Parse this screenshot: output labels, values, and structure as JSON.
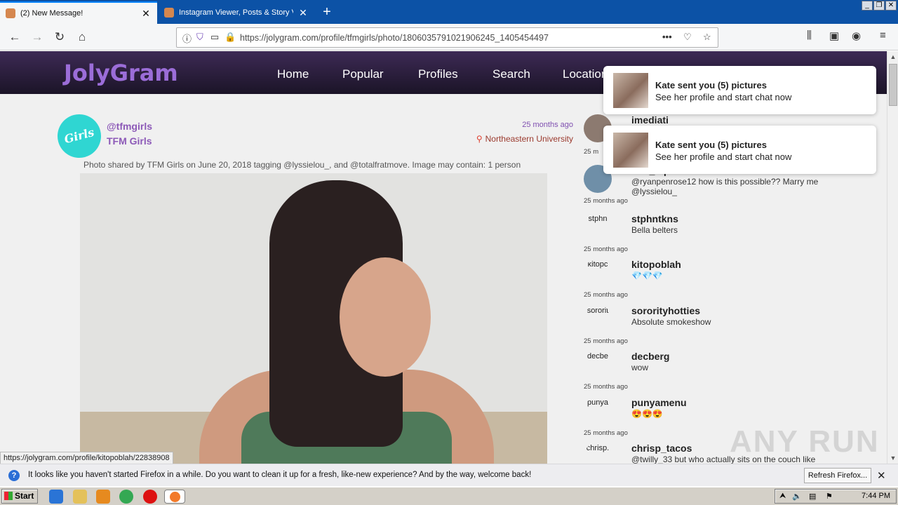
{
  "browser": {
    "tabs": [
      {
        "label": "(2) New Message!",
        "active": true
      },
      {
        "label": "Instagram Viewer, Posts & Story V",
        "active": false
      }
    ],
    "url": "https://jolygram.com/profile/tfmgirls/photo/1806035791021906245_1405454497",
    "status_url": "https://jolygram.com/profile/kitopoblah/22838908"
  },
  "site": {
    "logo": "JolyGram",
    "menu": [
      "Home",
      "Popular",
      "Profiles",
      "Search",
      "Locations"
    ]
  },
  "post": {
    "avatar_text": "Girls",
    "handle": "@tfmgirls",
    "display_name": "TFM Girls",
    "time": "25 months ago",
    "location": "Northeastern University",
    "caption": "Photo shared by TFM Girls on June 20, 2018 tagging @lyssielou_, and @totalfratmove. Image may contain: 1 person"
  },
  "comments": [
    {
      "avatar": "",
      "user": "imediati",
      "text": "",
      "time": "25 m"
    },
    {
      "avatar": "",
      "user": "brix_squaad",
      "text": "@ryanpenrose12 how is this possible?? Marry me @lyssielou_",
      "time": "25 months ago"
    },
    {
      "avatar": "stphn",
      "user": "stphntkns",
      "text": "Bella belters",
      "time": "25 months ago"
    },
    {
      "avatar": "kitopc",
      "user": "kitopoblah",
      "text": "💎💎💎",
      "time": "25 months ago"
    },
    {
      "avatar": "sororit",
      "user": "sororityhotties",
      "text": "Absolute smokeshow",
      "time": "25 months ago"
    },
    {
      "avatar": "decbe",
      "user": "decberg",
      "text": "wow",
      "time": "25 months ago"
    },
    {
      "avatar": "punya",
      "user": "punyamenu",
      "text": "😍😍😍",
      "time": "25 months ago"
    },
    {
      "avatar": "chrisp.",
      "user": "chrisp_tacos",
      "text": "@twilly_33 but who actually sits on the couch like",
      "time": ""
    }
  ],
  "notifications": [
    {
      "title": "Kate sent you (5) pictures",
      "sub": "See her profile and start chat now"
    },
    {
      "title": "Kate sent you (5) pictures",
      "sub": "See her profile and start chat now"
    }
  ],
  "infobar": {
    "text": "It looks like you haven't started Firefox in a while. Do you want to clean it up for a fresh, like-new experience? And by the way, welcome back!",
    "button": "Refresh Firefox..."
  },
  "taskbar": {
    "start": "Start",
    "clock": "7:44 PM"
  },
  "watermark": "ANY RUN"
}
